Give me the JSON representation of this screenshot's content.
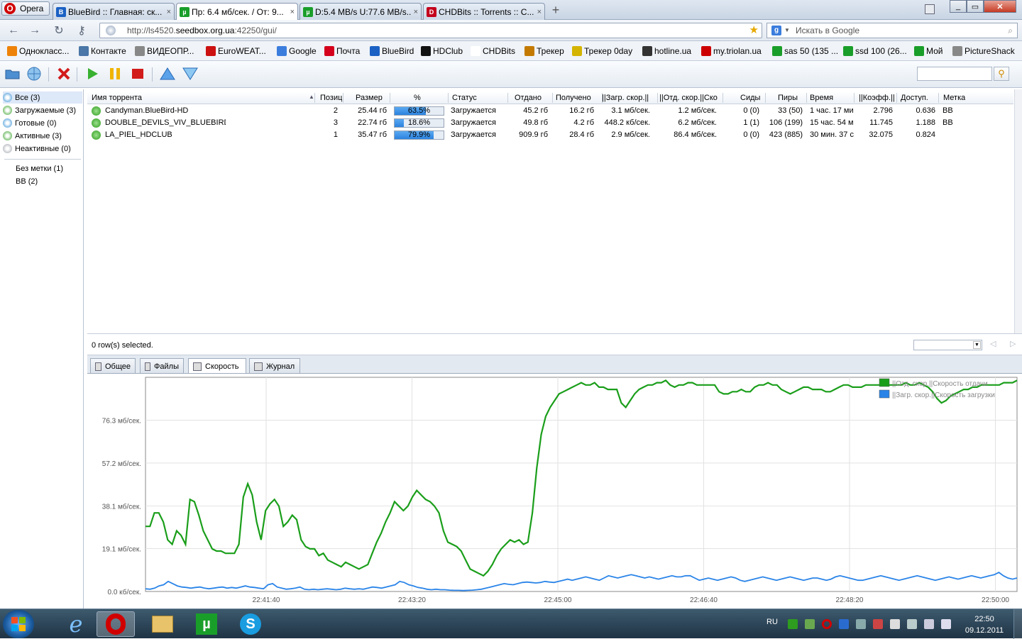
{
  "browser": {
    "menu_label": "Opera",
    "tabs": [
      {
        "label": "BlueBird :: Главная: ск...",
        "icon": "bluebird-icon",
        "color": "#1b61c4",
        "active": false
      },
      {
        "label": "Пр: 6.4 мб/сек. / От: 9...",
        "icon": "utorrent-icon",
        "color": "#1a9e2a",
        "active": true
      },
      {
        "label": "D:5.4 MB/s U:77.6 MB/s...",
        "icon": "utorrent-icon",
        "color": "#1a9e2a",
        "active": false
      },
      {
        "label": "CHDBits :: Torrents :: C...",
        "icon": "chdbits-icon",
        "color": "#c4001c",
        "active": false
      }
    ],
    "new_tab_symbol": "+",
    "close_symbol": "×",
    "address": {
      "prefix": "http://ls4520.",
      "host": "seedbox.org.ua",
      "suffix": ":42250/gui/"
    },
    "search_placeholder": "Искать в Google"
  },
  "bookmarks": [
    {
      "label": "Однокласс...",
      "color": "#ee8208"
    },
    {
      "label": "Контакте",
      "color": "#4a76a8"
    },
    {
      "label": "ВИДЕОПР...",
      "color": "#888888"
    },
    {
      "label": "EuroWEAT...",
      "color": "#cc1111"
    },
    {
      "label": "Google",
      "color": "#3b7ddd"
    },
    {
      "label": "Почта",
      "color": "#d4001c"
    },
    {
      "label": "BlueBird",
      "color": "#1b61c4"
    },
    {
      "label": "HDClub",
      "color": "#111111"
    },
    {
      "label": "CHDBits",
      "color": "#ffffff"
    },
    {
      "label": "Трекер",
      "color": "#c47a00"
    },
    {
      "label": "Трекер 0day",
      "color": "#d4b400"
    },
    {
      "label": "hotline.ua",
      "color": "#333333"
    },
    {
      "label": "my.triolan.ua",
      "color": "#cc0000"
    },
    {
      "label": "sas 50 (135 ...",
      "color": "#1a9e2a"
    },
    {
      "label": "ssd 100 (26...",
      "color": "#1a9e2a"
    },
    {
      "label": "Мой",
      "color": "#1a9e2a"
    },
    {
      "label": "PictureShack",
      "color": "#888888"
    }
  ],
  "sidebar": {
    "categories": [
      {
        "label": "Все (3)",
        "color": "#2a8ad4",
        "selected": true
      },
      {
        "label": "Загружаемые (3)",
        "color": "#2e9c1e",
        "selected": false
      },
      {
        "label": "Готовые (0)",
        "color": "#2a8ad4",
        "selected": false
      },
      {
        "label": "Активные (3)",
        "color": "#2e9c1e",
        "selected": false
      },
      {
        "label": "Неактивные (0)",
        "color": "#9aa0a8",
        "selected": false
      }
    ],
    "labels": [
      "Без метки (1)",
      "BB (2)"
    ]
  },
  "table": {
    "columns": [
      "Имя торрента",
      "Позиц",
      "Размер",
      "%",
      "Статус",
      "Отдано",
      "Получено",
      "||Загр. скор.||",
      "||Отд. скор.||Ско",
      "Сиды",
      "Пиры",
      "Время",
      "||Коэфф.||",
      "Доступ.",
      "Метка"
    ],
    "rows": [
      {
        "name": "Candyman.BlueBird-HD",
        "pos": "2",
        "size": "25.44 гб",
        "pct": "63.5%",
        "progress": 0.635,
        "status": "Загружается",
        "uploaded": "45.2 гб",
        "downloaded": "16.2 гб",
        "dl_speed": "3.1 мб/сек.",
        "ul_speed": "1.2 мб/сек.",
        "seeds": "0 (0)",
        "peers": "33 (50)",
        "eta": "1 час. 17 ми",
        "ratio": "2.796",
        "avail": "0.636",
        "label": "BB"
      },
      {
        "name": "DOUBLE_DEVILS_VIV_BLUEBIRD",
        "pos": "3",
        "size": "22.74 гб",
        "pct": "18.6%",
        "progress": 0.186,
        "status": "Загружается",
        "uploaded": "49.8 гб",
        "downloaded": "4.2 гб",
        "dl_speed": "448.2 кб/сек.",
        "ul_speed": "6.2 мб/сек.",
        "seeds": "1 (1)",
        "peers": "106 (199)",
        "eta": "15 час. 54 ми",
        "ratio": "11.745",
        "avail": "1.188",
        "label": "BB"
      },
      {
        "name": "LA_PIEL_HDCLUB",
        "pos": "1",
        "size": "35.47 гб",
        "pct": "79.9%",
        "progress": 0.799,
        "status": "Загружается",
        "uploaded": "909.9 гб",
        "downloaded": "28.4 гб",
        "dl_speed": "2.9 мб/сек.",
        "ul_speed": "86.4 мб/сек.",
        "seeds": "0 (0)",
        "peers": "423 (885)",
        "eta": "30 мин. 37 се",
        "ratio": "32.075",
        "avail": "0.824",
        "label": ""
      }
    ],
    "status_text": "0 row(s) selected."
  },
  "detail_tabs": [
    {
      "label": "Общее",
      "active": false
    },
    {
      "label": "Файлы",
      "active": false
    },
    {
      "label": "Скорость",
      "active": true
    },
    {
      "label": "Журнал",
      "active": false
    }
  ],
  "chart_data": {
    "type": "line",
    "ylim": [
      0,
      95.4
    ],
    "yticks": [
      {
        "value": 0,
        "label": "0.0 кб/сек."
      },
      {
        "value": 19.1,
        "label": "19.1 мб/сек."
      },
      {
        "value": 38.1,
        "label": "38.1 мб/сек."
      },
      {
        "value": 57.2,
        "label": "57.2 мб/сек."
      },
      {
        "value": 76.3,
        "label": "76.3 мб/сек."
      }
    ],
    "xticks": [
      "22:41:40",
      "22:43:20",
      "22:45:00",
      "22:46:40",
      "22:48:20",
      "22:50:00"
    ],
    "grid": true,
    "legend_position": "top-right",
    "series": [
      {
        "name": "||Отд. скор.||Скорость отдачи",
        "color": "#1a9e1a",
        "values": [
          29,
          29,
          35,
          35,
          31,
          23,
          21,
          27,
          25,
          21,
          41,
          40,
          34,
          27,
          23,
          19,
          18,
          18,
          17,
          17,
          17,
          21,
          42,
          48,
          43,
          31,
          23,
          36,
          39,
          41,
          38,
          29,
          31,
          34,
          32,
          23,
          20,
          19,
          19,
          16,
          17,
          14,
          13,
          12,
          11,
          13,
          12,
          11,
          10,
          11,
          12,
          17,
          22,
          26,
          31,
          35,
          40,
          38,
          36,
          38,
          42,
          45,
          43,
          41,
          40,
          38,
          35,
          27,
          22,
          21,
          20,
          18,
          14,
          10,
          9,
          8,
          7,
          9,
          12,
          16,
          19,
          21,
          23,
          22,
          23,
          21,
          22,
          35,
          55,
          70,
          78,
          82,
          85,
          88,
          89,
          90,
          91,
          92,
          93,
          92,
          92,
          93,
          91,
          91,
          90,
          90,
          90,
          84,
          82,
          85,
          88,
          90,
          91,
          92,
          92,
          93,
          93,
          94,
          92,
          91,
          92,
          92,
          93,
          93,
          92,
          92,
          92,
          92,
          92,
          89,
          88,
          88,
          89,
          89,
          90,
          89,
          89,
          91,
          92,
          92,
          93,
          92,
          92,
          90,
          89,
          88,
          89,
          90,
          91,
          91,
          90,
          90,
          90,
          89,
          89,
          90,
          91,
          92,
          92,
          91,
          91,
          91,
          92,
          92,
          92,
          92,
          92,
          92,
          92,
          92,
          92,
          93,
          92,
          92,
          93,
          92,
          91,
          89,
          86,
          84,
          85,
          87,
          88,
          89,
          90,
          90,
          91,
          91,
          92,
          92,
          92,
          92,
          92,
          93,
          93,
          93,
          94
        ]
      },
      {
        "name": "||Загр. скор.||Скорость загрузки",
        "color": "#2a84e8",
        "values": [
          1.2,
          1.0,
          1.5,
          2.5,
          3.0,
          4.5,
          3.5,
          2.5,
          2.0,
          1.8,
          1.5,
          1.8,
          2.0,
          1.5,
          1.2,
          1.5,
          1.8,
          2.0,
          1.5,
          1.8,
          1.5,
          2.0,
          2.5,
          2.0,
          1.8,
          1.5,
          1.2,
          3.0,
          3.5,
          2.0,
          1.5,
          1.0,
          1.2,
          1.5,
          2.0,
          1.0,
          0.8,
          1.0,
          0.8,
          1.0,
          1.2,
          1.0,
          0.8,
          1.0,
          1.5,
          1.2,
          1.0,
          1.2,
          1.0,
          1.5,
          2.0,
          1.8,
          1.5,
          2.0,
          2.5,
          3.0,
          4.5,
          4.0,
          3.0,
          2.5,
          1.8,
          1.5,
          1.0,
          0.8,
          1.0,
          0.8,
          0.8,
          0.6,
          0.5,
          0.5,
          0.4,
          0.5,
          0.6,
          0.8,
          1.0,
          1.5,
          2.0,
          2.5,
          3.0,
          3.5,
          3.2,
          3.0,
          3.5,
          4.0,
          4.2,
          4.0,
          3.8,
          4.0,
          4.5,
          4.2,
          4.0,
          4.5,
          5.0,
          5.5,
          5.0,
          5.5,
          6.0,
          6.5,
          6.0,
          5.5,
          5.0,
          6.0,
          7.0,
          6.5,
          6.0,
          6.5,
          7.0,
          7.5,
          7.0,
          6.5,
          6.0,
          6.5,
          6.0,
          5.5,
          6.0,
          6.5,
          7.0,
          6.5,
          6.5,
          7.0,
          7.0,
          6.0,
          5.0,
          5.5,
          6.0,
          5.5,
          5.0,
          5.5,
          6.0,
          6.5,
          6.0,
          5.0,
          4.5,
          5.0,
          5.5,
          6.0,
          6.5,
          6.0,
          5.5,
          5.0,
          5.5,
          6.0,
          6.5,
          6.0,
          5.5,
          5.0,
          5.5,
          6.0,
          6.0,
          5.5,
          5.0,
          5.5,
          6.5,
          7.0,
          6.5,
          6.0,
          5.5,
          5.0,
          5.0,
          5.5,
          6.0,
          6.5,
          7.0,
          6.5,
          6.0,
          5.5,
          5.0,
          5.5,
          6.0,
          6.5,
          7.0,
          6.5,
          6.0,
          5.5,
          5.0,
          5.5,
          6.0,
          6.5,
          6.0,
          5.5,
          6.0,
          6.5,
          7.0,
          6.5,
          6.0,
          6.5,
          7.0,
          7.5,
          8.5,
          7.0,
          6.0,
          5.5,
          6.0
        ]
      }
    ]
  },
  "taskbar": {
    "lang": "RU",
    "time": "22:50",
    "date": "09.12.2011"
  }
}
